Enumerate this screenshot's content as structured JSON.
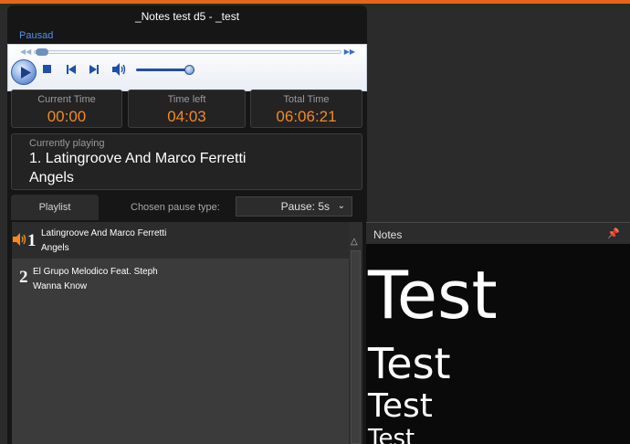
{
  "window": {
    "title": "_Notes test d5 - _test",
    "status": "Pausad"
  },
  "player": {
    "seek_back_icon": "rewind-icon",
    "seek_fwd_icon": "fast-forward-icon",
    "volume_level": 0.92
  },
  "times": {
    "current_label": "Current Time",
    "current_value": "00:00",
    "left_label": "Time left",
    "left_value": "04:03",
    "total_label": "Total Time",
    "total_value": "06:06:21"
  },
  "now_playing": {
    "label": "Currently playing",
    "line1": "1. Latingroove And Marco Ferretti",
    "line2": "Angels"
  },
  "playlist": {
    "tab_label": "Playlist",
    "pause_type_label": "Chosen pause type:",
    "pause_value": "Pause: 5s",
    "items": [
      {
        "num": "1",
        "artist": "Latingroove And Marco Ferretti",
        "title": "Angels"
      },
      {
        "num": "2",
        "artist": "El Grupo Melodico Feat. Steph",
        "title": "Wanna Know"
      }
    ]
  },
  "notes": {
    "title": "Notes",
    "lines": [
      "Test",
      "Test",
      "Test",
      "Test"
    ]
  },
  "colors": {
    "accent": "#f08a2a",
    "topline": "#e8641c",
    "status": "#5b8ce6"
  }
}
